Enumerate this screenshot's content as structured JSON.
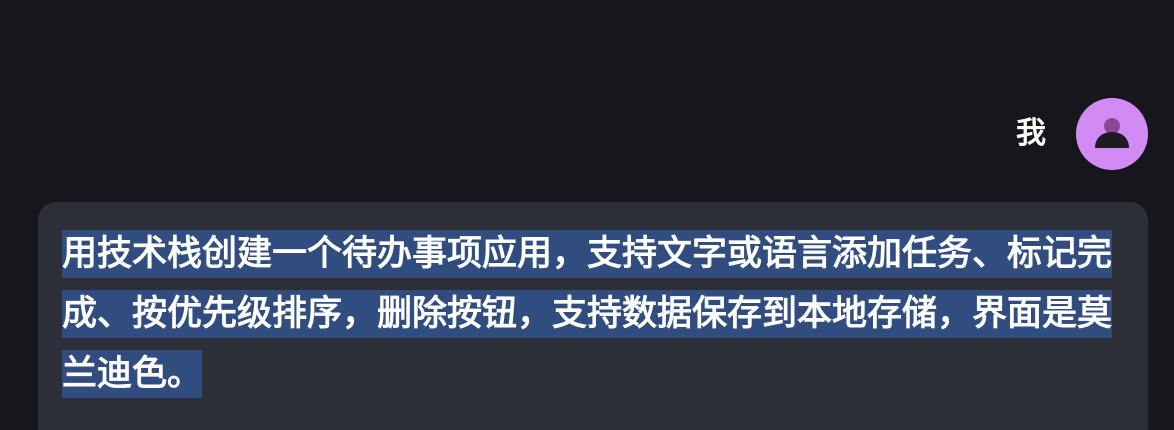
{
  "user": {
    "name": "我",
    "avatar_icon": "user-icon"
  },
  "message": {
    "text": "用技术栈创建一个待办事项应用，支持文字或语言添加任务、标记完成、按优先级排序，删除按钮，支持数据保存到本地存储，界面是莫兰迪色。",
    "selected": true
  },
  "colors": {
    "background": "#16171c",
    "bubble": "#2c2f38",
    "selection": "#314d80",
    "avatar": "#d28bf4",
    "text": "#ffffff"
  }
}
